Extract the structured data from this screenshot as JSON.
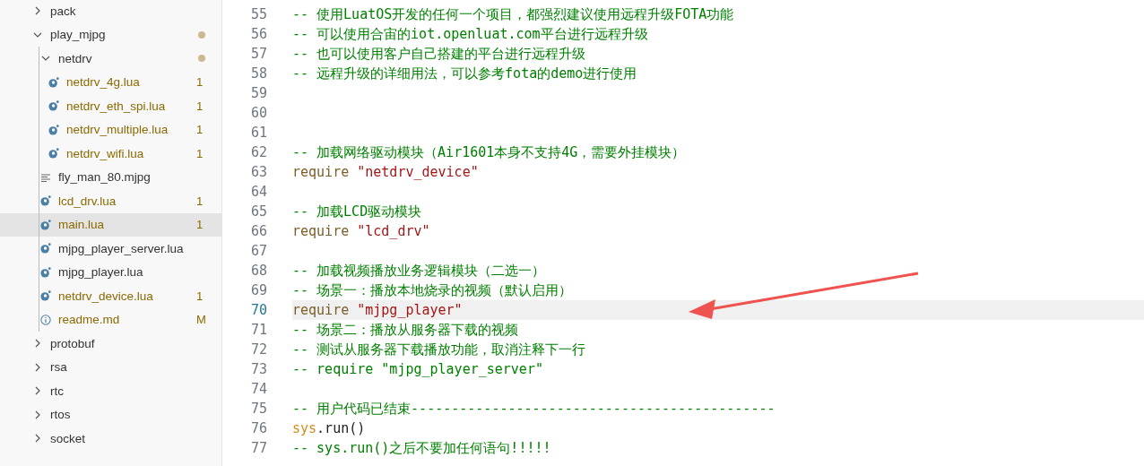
{
  "explorer": {
    "items": [
      {
        "name": "pack",
        "kind": "folder",
        "expanded": false,
        "selected": false,
        "warning": false,
        "dot": false
      },
      {
        "name": "play_mjpg",
        "kind": "folder",
        "expanded": true,
        "selected": false,
        "warning": false,
        "dot": true,
        "children": [
          {
            "name": "netdrv",
            "kind": "folder",
            "expanded": true,
            "selected": false,
            "warning": false,
            "dot": true,
            "children": [
              {
                "name": "netdrv_4g.lua",
                "kind": "lua",
                "selected": false,
                "warning": true,
                "badge": "1"
              },
              {
                "name": "netdrv_eth_spi.lua",
                "kind": "lua",
                "selected": false,
                "warning": true,
                "badge": "1"
              },
              {
                "name": "netdrv_multiple.lua",
                "kind": "lua",
                "selected": false,
                "warning": true,
                "badge": "1"
              },
              {
                "name": "netdrv_wifi.lua",
                "kind": "lua",
                "selected": false,
                "warning": true,
                "badge": "1"
              }
            ]
          },
          {
            "name": "fly_man_80.mjpg",
            "kind": "text",
            "selected": false,
            "warning": false
          },
          {
            "name": "lcd_drv.lua",
            "kind": "lua",
            "selected": false,
            "warning": true,
            "badge": "1"
          },
          {
            "name": "main.lua",
            "kind": "lua",
            "selected": true,
            "warning": true,
            "badge": "1"
          },
          {
            "name": "mjpg_player_server.lua",
            "kind": "lua",
            "selected": false,
            "warning": false
          },
          {
            "name": "mjpg_player.lua",
            "kind": "lua",
            "selected": false,
            "warning": false
          },
          {
            "name": "netdrv_device.lua",
            "kind": "lua",
            "selected": false,
            "warning": true,
            "badge": "1"
          },
          {
            "name": "readme.md",
            "kind": "info",
            "selected": false,
            "warning": true,
            "badge": "M"
          }
        ]
      },
      {
        "name": "protobuf",
        "kind": "folder",
        "expanded": false,
        "selected": false,
        "warning": false,
        "dot": false
      },
      {
        "name": "rsa",
        "kind": "folder",
        "expanded": false,
        "selected": false,
        "warning": false,
        "dot": false
      },
      {
        "name": "rtc",
        "kind": "folder",
        "expanded": false,
        "selected": false,
        "warning": false,
        "dot": false
      },
      {
        "name": "rtos",
        "kind": "folder",
        "expanded": false,
        "selected": false,
        "warning": false,
        "dot": false
      },
      {
        "name": "socket",
        "kind": "folder",
        "expanded": false,
        "selected": false,
        "warning": false,
        "dot": false
      }
    ]
  },
  "editor": {
    "lines": [
      {
        "number": "55",
        "selected": false,
        "tokens": [
          {
            "kind": "comment",
            "text": "-- 使用LuatOS开发的任何一个项目，都强烈建议使用远程升级FOTA功能"
          }
        ]
      },
      {
        "number": "56",
        "selected": false,
        "tokens": [
          {
            "kind": "comment",
            "text": "-- 可以使用合宙的iot.openluat.com平台进行远程升级"
          }
        ]
      },
      {
        "number": "57",
        "selected": false,
        "tokens": [
          {
            "kind": "comment",
            "text": "-- 也可以使用客户自己搭建的平台进行远程升级"
          }
        ]
      },
      {
        "number": "58",
        "selected": false,
        "tokens": [
          {
            "kind": "comment",
            "text": "-- 远程升级的详细用法，可以参考fota的demo进行使用"
          }
        ]
      },
      {
        "number": "59",
        "selected": false
      },
      {
        "number": "60",
        "selected": false
      },
      {
        "number": "61",
        "selected": false
      },
      {
        "number": "62",
        "selected": false,
        "tokens": [
          {
            "kind": "comment",
            "text": "-- 加载网络驱动模块（Air1601本身不支持4G，需要外挂模块）"
          }
        ]
      },
      {
        "number": "63",
        "selected": false,
        "tokens": [
          {
            "kind": "keyword",
            "text": "require "
          },
          {
            "kind": "string",
            "text": "\"netdrv_device\""
          }
        ]
      },
      {
        "number": "64",
        "selected": false
      },
      {
        "number": "65",
        "selected": false,
        "tokens": [
          {
            "kind": "comment",
            "text": "-- 加载LCD驱动模块"
          }
        ]
      },
      {
        "number": "66",
        "selected": false,
        "tokens": [
          {
            "kind": "keyword",
            "text": "require "
          },
          {
            "kind": "string",
            "text": "\"lcd_drv\""
          }
        ]
      },
      {
        "number": "67",
        "selected": false
      },
      {
        "number": "68",
        "selected": false,
        "tokens": [
          {
            "kind": "comment",
            "text": "-- 加载视频播放业务逻辑模块（二选一）"
          }
        ]
      },
      {
        "number": "69",
        "selected": false,
        "tokens": [
          {
            "kind": "comment",
            "text": "-- 场景一：播放本地烧录的视频（默认启用）"
          }
        ]
      },
      {
        "number": "70",
        "selected": true,
        "tokens": [
          {
            "kind": "keyword",
            "text": "require "
          },
          {
            "kind": "string",
            "text": "\"mjpg_player\""
          }
        ]
      },
      {
        "number": "71",
        "selected": false,
        "tokens": [
          {
            "kind": "comment",
            "text": "-- 场景二：播放从服务器下载的视频"
          }
        ]
      },
      {
        "number": "72",
        "selected": false,
        "tokens": [
          {
            "kind": "comment",
            "text": "-- 测试从服务器下载播放功能，取消注释下一行"
          }
        ]
      },
      {
        "number": "73",
        "selected": false,
        "tokens": [
          {
            "kind": "comment",
            "text": "-- require \"mjpg_player_server\""
          }
        ]
      },
      {
        "number": "74",
        "selected": false
      },
      {
        "number": "75",
        "selected": false,
        "tokens": [
          {
            "kind": "comment",
            "text": "-- 用户代码已结束---------------------------------------------"
          }
        ]
      },
      {
        "number": "76",
        "selected": false,
        "tokens": [
          {
            "kind": "builtin",
            "text": "sys"
          },
          {
            "kind": "plain",
            "text": ".run()"
          }
        ]
      },
      {
        "number": "77",
        "selected": false,
        "tokens": [
          {
            "kind": "comment",
            "text": "-- sys.run()之后不要加任何语句!!!!!"
          }
        ]
      }
    ]
  }
}
